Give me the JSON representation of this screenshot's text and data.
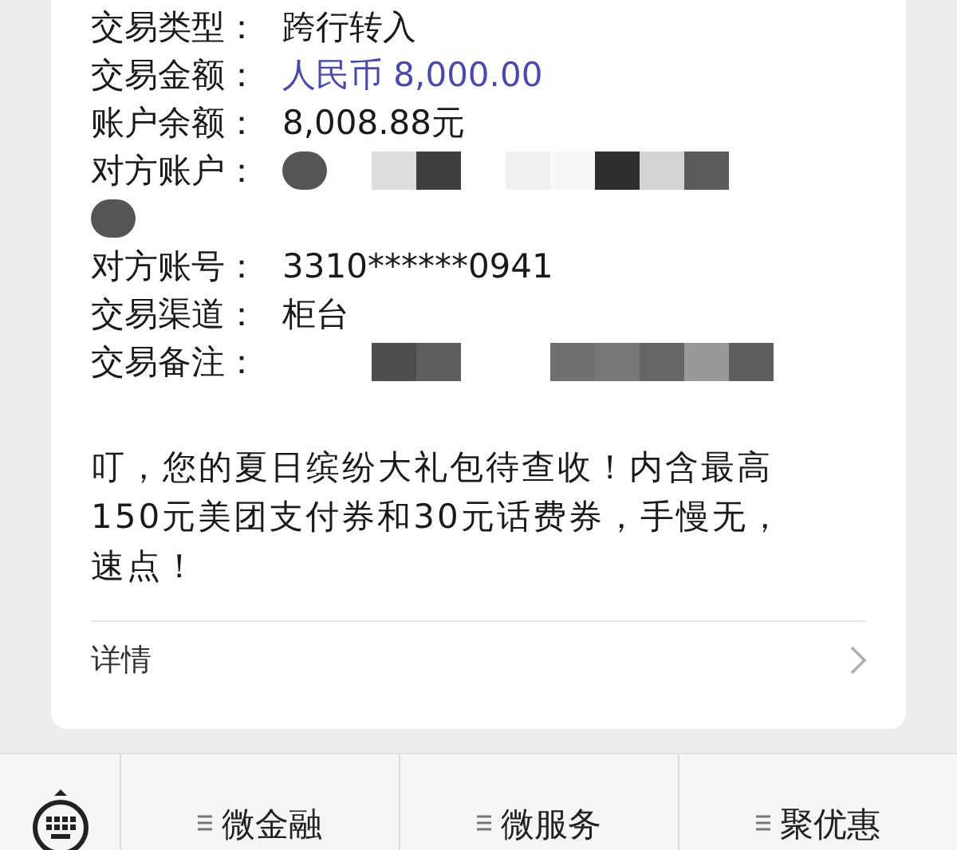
{
  "details": [
    {
      "label": "交易类型：",
      "kind": "text",
      "value": "跨行转入",
      "highlighted": false
    },
    {
      "label": "交易金额：",
      "kind": "text",
      "value": "人民币 8,000.00",
      "highlighted": true
    },
    {
      "label": "账户余额：",
      "kind": "text",
      "value": "8,008.88元",
      "highlighted": false
    },
    {
      "label": "对方账户：",
      "kind": "masked_long"
    },
    {
      "label": "对方账号：",
      "kind": "text",
      "value": "3310******0941",
      "highlighted": false
    },
    {
      "label": "交易渠道：",
      "kind": "text",
      "value": "柜台",
      "highlighted": false
    },
    {
      "label": "交易备注：",
      "kind": "masked"
    }
  ],
  "message": "叮，您的夏日缤纷大礼包待查收！内含最高150元美团支付券和30元话费券，手慢无，速点！",
  "details_link": "详情",
  "menu": [
    {
      "label": "微金融"
    },
    {
      "label": "微服务"
    },
    {
      "label": "聚优惠"
    }
  ]
}
